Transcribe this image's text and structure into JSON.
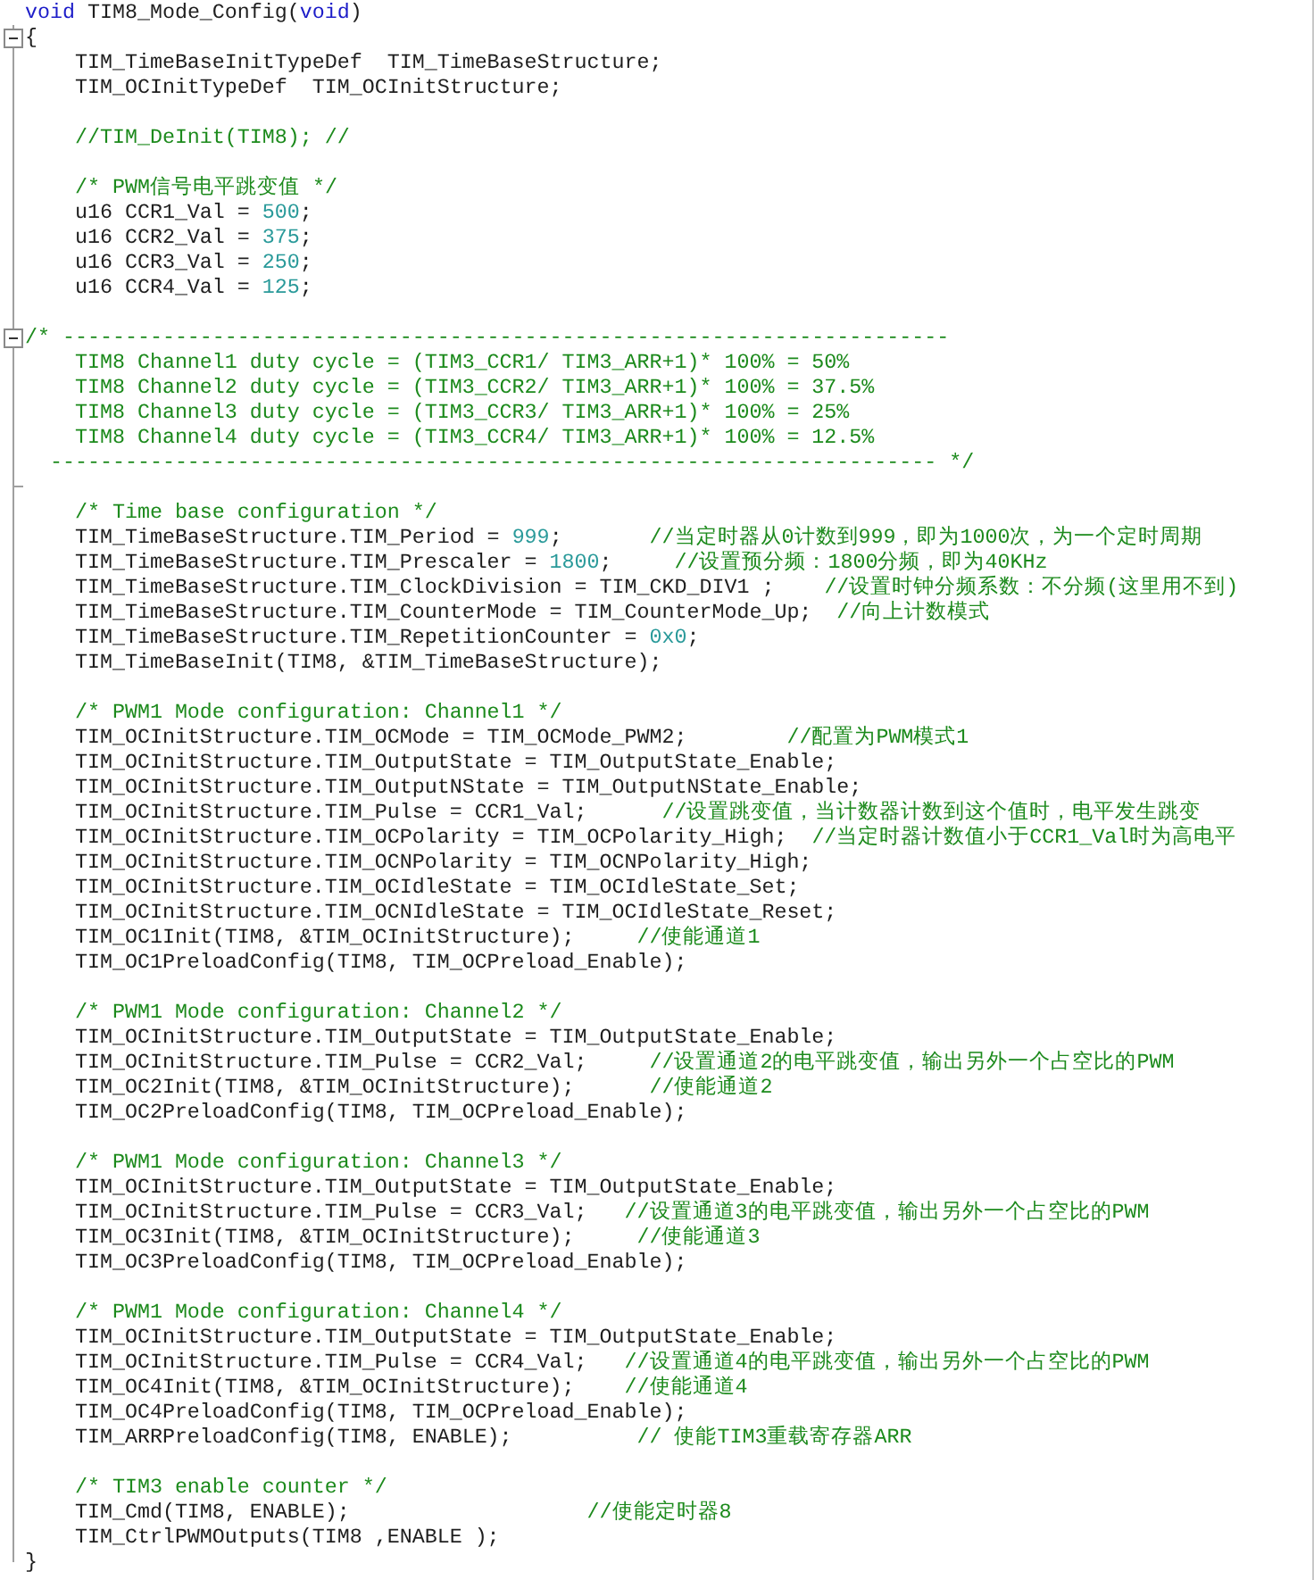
{
  "lines": [
    {
      "collapsible": false,
      "fold_end": false,
      "segs": [
        {
          "kind": "keyword",
          "text": "void"
        },
        {
          "kind": "code",
          "text": " TIM8_Mode_Config("
        },
        {
          "kind": "keyword",
          "text": "void"
        },
        {
          "kind": "code",
          "text": ")"
        }
      ]
    },
    {
      "collapsible": true,
      "fold_end": false,
      "segs": [
        {
          "kind": "code",
          "text": "{"
        }
      ]
    },
    {
      "collapsible": false,
      "fold_end": false,
      "segs": [
        {
          "kind": "code",
          "text": "    TIM_TimeBaseInitTypeDef  TIM_TimeBaseStructure;"
        }
      ]
    },
    {
      "collapsible": false,
      "fold_end": false,
      "segs": [
        {
          "kind": "code",
          "text": "    TIM_OCInitTypeDef  TIM_OCInitStructure;"
        }
      ]
    },
    {
      "collapsible": false,
      "fold_end": false
    },
    {
      "collapsible": false,
      "fold_end": false,
      "segs": [
        {
          "kind": "comment",
          "text": "    //TIM_DeInit(TIM8); //"
        }
      ]
    },
    {
      "collapsible": false,
      "fold_end": false
    },
    {
      "collapsible": false,
      "fold_end": false,
      "segs": [
        {
          "kind": "comment",
          "text": "    /* PWM信号电平跳变值 */"
        }
      ]
    },
    {
      "collapsible": false,
      "fold_end": false,
      "segs": [
        {
          "kind": "code",
          "text": "    u16 CCR1_Val = "
        },
        {
          "kind": "number",
          "text": "500"
        },
        {
          "kind": "code",
          "text": ";"
        }
      ]
    },
    {
      "collapsible": false,
      "fold_end": false,
      "segs": [
        {
          "kind": "code",
          "text": "    u16 CCR2_Val = "
        },
        {
          "kind": "number",
          "text": "375"
        },
        {
          "kind": "code",
          "text": ";"
        }
      ]
    },
    {
      "collapsible": false,
      "fold_end": false,
      "segs": [
        {
          "kind": "code",
          "text": "    u16 CCR3_Val = "
        },
        {
          "kind": "number",
          "text": "250"
        },
        {
          "kind": "code",
          "text": ";"
        }
      ]
    },
    {
      "collapsible": false,
      "fold_end": false,
      "segs": [
        {
          "kind": "code",
          "text": "    u16 CCR4_Val = "
        },
        {
          "kind": "number",
          "text": "125"
        },
        {
          "kind": "code",
          "text": ";"
        }
      ]
    },
    {
      "collapsible": false,
      "fold_end": false
    },
    {
      "collapsible": true,
      "fold_end": false,
      "segs": [
        {
          "kind": "comment",
          "text": "/* -----------------------------------------------------------------------"
        }
      ]
    },
    {
      "collapsible": false,
      "fold_end": false,
      "segs": [
        {
          "kind": "comment",
          "text": "    TIM8 Channel1 duty cycle = (TIM3_CCR1/ TIM3_ARR+1)* 100% = 50%"
        }
      ]
    },
    {
      "collapsible": false,
      "fold_end": false,
      "segs": [
        {
          "kind": "comment",
          "text": "    TIM8 Channel2 duty cycle = (TIM3_CCR2/ TIM3_ARR+1)* 100% = 37.5%"
        }
      ]
    },
    {
      "collapsible": false,
      "fold_end": false,
      "segs": [
        {
          "kind": "comment",
          "text": "    TIM8 Channel3 duty cycle = (TIM3_CCR3/ TIM3_ARR+1)* 100% = 25%"
        }
      ]
    },
    {
      "collapsible": false,
      "fold_end": false,
      "segs": [
        {
          "kind": "comment",
          "text": "    TIM8 Channel4 duty cycle = (TIM3_CCR4/ TIM3_ARR+1)* 100% = 12.5%"
        }
      ]
    },
    {
      "collapsible": false,
      "fold_end": false,
      "segs": [
        {
          "kind": "comment",
          "text": "  ----------------------------------------------------------------------- */"
        }
      ]
    },
    {
      "collapsible": false,
      "fold_end": true
    },
    {
      "collapsible": false,
      "fold_end": false,
      "segs": [
        {
          "kind": "comment",
          "text": "    /* Time base configuration */"
        }
      ]
    },
    {
      "collapsible": false,
      "fold_end": false,
      "segs": [
        {
          "kind": "code",
          "text": "    TIM_TimeBaseStructure.TIM_Period = "
        },
        {
          "kind": "number",
          "text": "999"
        },
        {
          "kind": "code",
          "text": ";"
        },
        {
          "kind": "comment",
          "text": "       //当定时器从0计数到999，即为1000次，为一个定时周期"
        }
      ]
    },
    {
      "collapsible": false,
      "fold_end": false,
      "segs": [
        {
          "kind": "code",
          "text": "    TIM_TimeBaseStructure.TIM_Prescaler = "
        },
        {
          "kind": "number",
          "text": "1800"
        },
        {
          "kind": "code",
          "text": ";"
        },
        {
          "kind": "comment",
          "text": "     //设置预分频：1800分频，即为40KHz"
        }
      ]
    },
    {
      "collapsible": false,
      "fold_end": false,
      "segs": [
        {
          "kind": "code",
          "text": "    TIM_TimeBaseStructure.TIM_ClockDivision = TIM_CKD_DIV1 ;    "
        },
        {
          "kind": "comment",
          "text": "//设置时钟分频系数：不分频(这里用不到)"
        }
      ]
    },
    {
      "collapsible": false,
      "fold_end": false,
      "segs": [
        {
          "kind": "code",
          "text": "    TIM_TimeBaseStructure.TIM_CounterMode = TIM_CounterMode_Up;  "
        },
        {
          "kind": "comment",
          "text": "//向上计数模式"
        }
      ]
    },
    {
      "collapsible": false,
      "fold_end": false,
      "segs": [
        {
          "kind": "code",
          "text": "    TIM_TimeBaseStructure.TIM_RepetitionCounter = "
        },
        {
          "kind": "number",
          "text": "0x0"
        },
        {
          "kind": "code",
          "text": ";"
        }
      ]
    },
    {
      "collapsible": false,
      "fold_end": false,
      "segs": [
        {
          "kind": "code",
          "text": "    TIM_TimeBaseInit(TIM8, &TIM_TimeBaseStructure);"
        }
      ]
    },
    {
      "collapsible": false,
      "fold_end": false
    },
    {
      "collapsible": false,
      "fold_end": false,
      "segs": [
        {
          "kind": "comment",
          "text": "    /* PWM1 Mode configuration: Channel1 */"
        }
      ]
    },
    {
      "collapsible": false,
      "fold_end": false,
      "segs": [
        {
          "kind": "code",
          "text": "    TIM_OCInitStructure.TIM_OCMode = TIM_OCMode_PWM2;        "
        },
        {
          "kind": "comment",
          "text": "//配置为PWM模式1"
        }
      ]
    },
    {
      "collapsible": false,
      "fold_end": false,
      "segs": [
        {
          "kind": "code",
          "text": "    TIM_OCInitStructure.TIM_OutputState = TIM_OutputState_Enable;"
        }
      ]
    },
    {
      "collapsible": false,
      "fold_end": false,
      "segs": [
        {
          "kind": "code",
          "text": "    TIM_OCInitStructure.TIM_OutputNState = TIM_OutputNState_Enable;"
        }
      ]
    },
    {
      "collapsible": false,
      "fold_end": false,
      "segs": [
        {
          "kind": "code",
          "text": "    TIM_OCInitStructure.TIM_Pulse = CCR1_Val;      "
        },
        {
          "kind": "comment",
          "text": "//设置跳变值，当计数器计数到这个值时，电平发生跳变"
        }
      ]
    },
    {
      "collapsible": false,
      "fold_end": false,
      "segs": [
        {
          "kind": "code",
          "text": "    TIM_OCInitStructure.TIM_OCPolarity = TIM_OCPolarity_High;  "
        },
        {
          "kind": "comment",
          "text": "//当定时器计数值小于CCR1_Val时为高电平"
        }
      ]
    },
    {
      "collapsible": false,
      "fold_end": false,
      "segs": [
        {
          "kind": "code",
          "text": "    TIM_OCInitStructure.TIM_OCNPolarity = TIM_OCNPolarity_High;"
        }
      ]
    },
    {
      "collapsible": false,
      "fold_end": false,
      "segs": [
        {
          "kind": "code",
          "text": "    TIM_OCInitStructure.TIM_OCIdleState = TIM_OCIdleState_Set;"
        }
      ]
    },
    {
      "collapsible": false,
      "fold_end": false,
      "segs": [
        {
          "kind": "code",
          "text": "    TIM_OCInitStructure.TIM_OCNIdleState = TIM_OCIdleState_Reset;"
        }
      ]
    },
    {
      "collapsible": false,
      "fold_end": false,
      "segs": [
        {
          "kind": "code",
          "text": "    TIM_OC1Init(TIM8, &TIM_OCInitStructure);     "
        },
        {
          "kind": "comment",
          "text": "//使能通道1"
        }
      ]
    },
    {
      "collapsible": false,
      "fold_end": false,
      "segs": [
        {
          "kind": "code",
          "text": "    TIM_OC1PreloadConfig(TIM8, TIM_OCPreload_Enable);"
        }
      ]
    },
    {
      "collapsible": false,
      "fold_end": false
    },
    {
      "collapsible": false,
      "fold_end": false,
      "segs": [
        {
          "kind": "comment",
          "text": "    /* PWM1 Mode configuration: Channel2 */"
        }
      ]
    },
    {
      "collapsible": false,
      "fold_end": false,
      "segs": [
        {
          "kind": "code",
          "text": "    TIM_OCInitStructure.TIM_OutputState = TIM_OutputState_Enable;"
        }
      ]
    },
    {
      "collapsible": false,
      "fold_end": false,
      "segs": [
        {
          "kind": "code",
          "text": "    TIM_OCInitStructure.TIM_Pulse = CCR2_Val;     "
        },
        {
          "kind": "comment",
          "text": "//设置通道2的电平跳变值，输出另外一个占空比的PWM"
        }
      ]
    },
    {
      "collapsible": false,
      "fold_end": false,
      "segs": [
        {
          "kind": "code",
          "text": "    TIM_OC2Init(TIM8, &TIM_OCInitStructure);      "
        },
        {
          "kind": "comment",
          "text": "//使能通道2"
        }
      ]
    },
    {
      "collapsible": false,
      "fold_end": false,
      "segs": [
        {
          "kind": "code",
          "text": "    TIM_OC2PreloadConfig(TIM8, TIM_OCPreload_Enable);"
        }
      ]
    },
    {
      "collapsible": false,
      "fold_end": false
    },
    {
      "collapsible": false,
      "fold_end": false,
      "segs": [
        {
          "kind": "comment",
          "text": "    /* PWM1 Mode configuration: Channel3 */"
        }
      ]
    },
    {
      "collapsible": false,
      "fold_end": false,
      "segs": [
        {
          "kind": "code",
          "text": "    TIM_OCInitStructure.TIM_OutputState = TIM_OutputState_Enable;"
        }
      ]
    },
    {
      "collapsible": false,
      "fold_end": false,
      "segs": [
        {
          "kind": "code",
          "text": "    TIM_OCInitStructure.TIM_Pulse = CCR3_Val;   "
        },
        {
          "kind": "comment",
          "text": "//设置通道3的电平跳变值，输出另外一个占空比的PWM"
        }
      ]
    },
    {
      "collapsible": false,
      "fold_end": false,
      "segs": [
        {
          "kind": "code",
          "text": "    TIM_OC3Init(TIM8, &TIM_OCInitStructure);     "
        },
        {
          "kind": "comment",
          "text": "//使能通道3"
        }
      ]
    },
    {
      "collapsible": false,
      "fold_end": false,
      "segs": [
        {
          "kind": "code",
          "text": "    TIM_OC3PreloadConfig(TIM8, TIM_OCPreload_Enable);"
        }
      ]
    },
    {
      "collapsible": false,
      "fold_end": false
    },
    {
      "collapsible": false,
      "fold_end": false,
      "segs": [
        {
          "kind": "comment",
          "text": "    /* PWM1 Mode configuration: Channel4 */"
        }
      ]
    },
    {
      "collapsible": false,
      "fold_end": false,
      "segs": [
        {
          "kind": "code",
          "text": "    TIM_OCInitStructure.TIM_OutputState = TIM_OutputState_Enable;"
        }
      ]
    },
    {
      "collapsible": false,
      "fold_end": false,
      "segs": [
        {
          "kind": "code",
          "text": "    TIM_OCInitStructure.TIM_Pulse = CCR4_Val;   "
        },
        {
          "kind": "comment",
          "text": "//设置通道4的电平跳变值，输出另外一个占空比的PWM"
        }
      ]
    },
    {
      "collapsible": false,
      "fold_end": false,
      "segs": [
        {
          "kind": "code",
          "text": "    TIM_OC4Init(TIM8, &TIM_OCInitStructure);    "
        },
        {
          "kind": "comment",
          "text": "//使能通道4"
        }
      ]
    },
    {
      "collapsible": false,
      "fold_end": false,
      "segs": [
        {
          "kind": "code",
          "text": "    TIM_OC4PreloadConfig(TIM8, TIM_OCPreload_Enable);"
        }
      ]
    },
    {
      "collapsible": false,
      "fold_end": false,
      "segs": [
        {
          "kind": "code",
          "text": "    TIM_ARRPreloadConfig(TIM8, ENABLE);          "
        },
        {
          "kind": "comment",
          "text": "// 使能TIM3重载寄存器ARR"
        }
      ]
    },
    {
      "collapsible": false,
      "fold_end": false
    },
    {
      "collapsible": false,
      "fold_end": false,
      "segs": [
        {
          "kind": "comment",
          "text": "    /* TIM3 enable counter */"
        }
      ]
    },
    {
      "collapsible": false,
      "fold_end": false,
      "segs": [
        {
          "kind": "code",
          "text": "    TIM_Cmd(TIM8, ENABLE);                   "
        },
        {
          "kind": "comment",
          "text": "//使能定时器8"
        }
      ]
    },
    {
      "collapsible": false,
      "fold_end": false,
      "segs": [
        {
          "kind": "code",
          "text": "    TIM_CtrlPWMOutputs(TIM8 ,ENABLE );"
        }
      ]
    },
    {
      "collapsible": false,
      "fold_end": false,
      "segs": [
        {
          "kind": "code",
          "text": "}"
        }
      ]
    }
  ]
}
